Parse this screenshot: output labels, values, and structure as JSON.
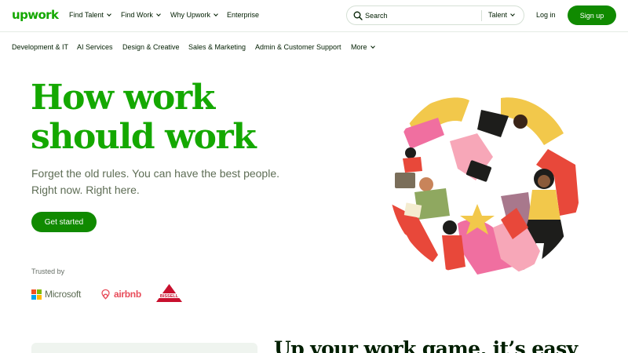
{
  "header": {
    "logo": "upwork",
    "nav": [
      {
        "label": "Find Talent",
        "has_dropdown": true
      },
      {
        "label": "Find Work",
        "has_dropdown": true
      },
      {
        "label": "Why Upwork",
        "has_dropdown": true
      },
      {
        "label": "Enterprise",
        "has_dropdown": false
      }
    ],
    "search": {
      "placeholder": "Search",
      "scope": "Talent",
      "icon": "search-icon"
    },
    "login": "Log in",
    "signup": "Sign up"
  },
  "categories": [
    {
      "label": "Development & IT"
    },
    {
      "label": "AI Services"
    },
    {
      "label": "Design & Creative"
    },
    {
      "label": "Sales & Marketing"
    },
    {
      "label": "Admin & Customer Support"
    },
    {
      "label": "More",
      "has_dropdown": true
    }
  ],
  "hero": {
    "title_line1": "How work",
    "title_line2": "should work",
    "subtitle": "Forget the old rules. You can have the best people. Right now. Right here.",
    "cta": "Get started"
  },
  "trusted": {
    "label": "Trusted by",
    "brands": [
      "Microsoft",
      "airbnb",
      "BISSELL"
    ]
  },
  "lower": {
    "heading": "Up your work game, it’s easy"
  },
  "colors": {
    "brand_green": "#14a800",
    "button_green": "#108a00",
    "text_dark": "#001e00",
    "text_muted": "#5e6d55"
  }
}
